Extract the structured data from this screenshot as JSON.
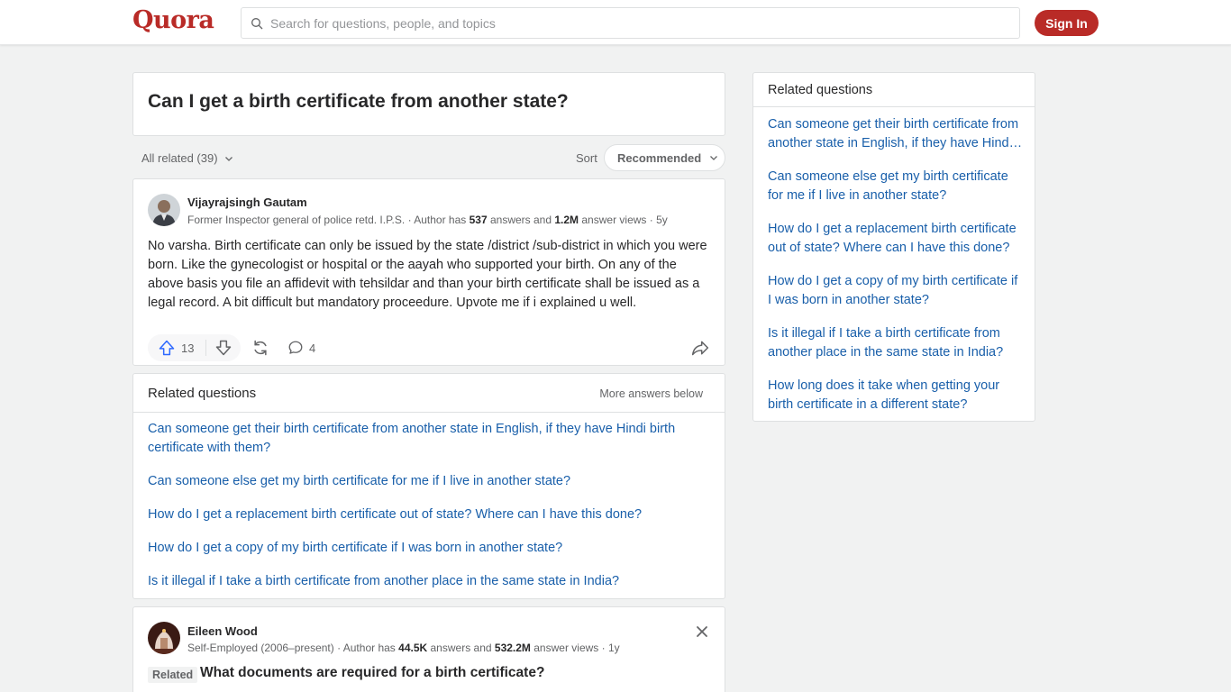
{
  "header": {
    "logo": "Quora",
    "search_placeholder": "Search for questions, people, and topics",
    "signin_label": "Sign In"
  },
  "question": {
    "title": "Can I get a birth certificate from another state?"
  },
  "filters": {
    "all_related": "All related (39)",
    "sort_label": "Sort",
    "sort_value": "Recommended"
  },
  "answer": {
    "author": "Vijayrajsingh Gautam",
    "credential_prefix": "Former Inspector general of police retd. I.P.S. · Author has ",
    "answers_count": "537",
    "answers_mid": " answers and ",
    "views_count": "1.2M",
    "views_suffix": " answer views · 5y",
    "body": "No varsha. Birth certificate can only be issued by the state /district /sub-district in which you were born. Like the gynecologist or hospital or the aayah who supported your birth. On any of the above basis you file an affidevit with tehsildar and than your birth certificate shall be issued as a legal record. A bit difficult but mandatory proceedure. Upvote me if i explained u well.",
    "upvotes": "13",
    "comments": "4"
  },
  "related_feed": {
    "title": "Related questions",
    "more_label": "More answers below",
    "items": [
      "Can someone get their birth certificate from another state in English, if they have Hindi birth certificate with them?",
      "Can someone else get my birth certificate for me if I live in another state?",
      "How do I get a replacement birth certificate out of state? Where can I have this done?",
      "How do I get a copy of my birth certificate if I was born in another state?",
      "Is it illegal if I take a birth certificate from another place in the same state in India?"
    ]
  },
  "answer2": {
    "author": "Eileen Wood",
    "credential_prefix": "Self-Employed (2006–present) · Author has ",
    "answers_count": "44.5K",
    "answers_mid": " answers and ",
    "views_count": "532.2M",
    "views_suffix": " answer views · 1y",
    "related_tag": "Related",
    "related_title": "What documents are required for a birth certificate?"
  },
  "sidebar": {
    "title": "Related questions",
    "items": [
      "Can someone get their birth certificate from another state in English, if they have Hindi birth certificate with them?",
      "Can someone else get my birth certificate for me if I live in another state?",
      "How do I get a replacement birth certificate out of state? Where can I have this done?",
      "How do I get a copy of my birth certificate if I was born in another state?",
      "Is it illegal if I take a birth certificate from another place in the same state in India?",
      "How long does it take when getting your birth certificate in a different state?"
    ]
  },
  "colors": {
    "brand": "#b92b27",
    "link": "#195faa",
    "upvote": "#2e69ff"
  }
}
